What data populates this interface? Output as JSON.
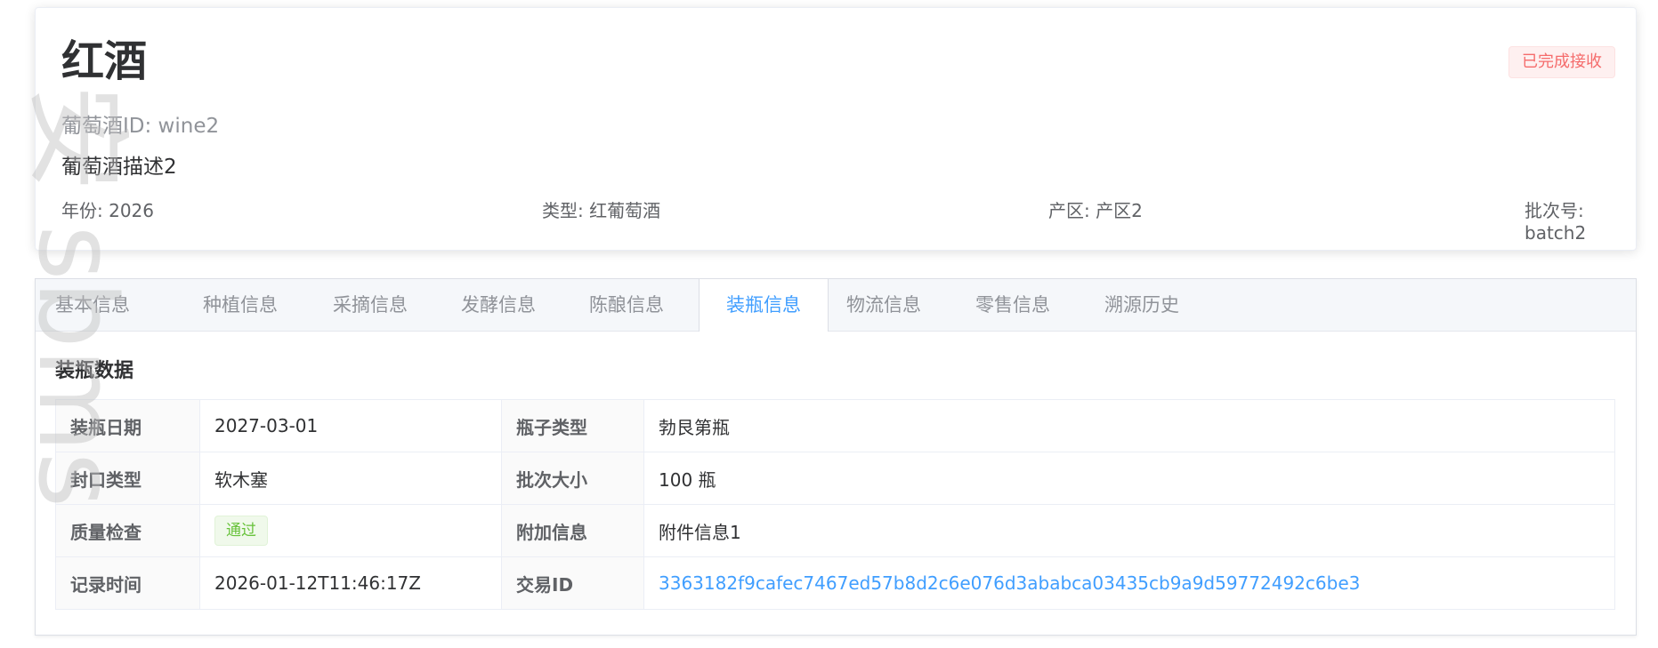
{
  "header": {
    "title": "红酒",
    "wine_id": "葡萄酒ID: wine2",
    "description": "葡萄酒描述2",
    "status": "已完成接收",
    "meta": [
      {
        "label": "年份: 2026"
      },
      {
        "label": "类型: 红葡萄酒"
      },
      {
        "label": "产区: 产区2"
      },
      {
        "label": "批次号: batch2"
      }
    ]
  },
  "tabs": [
    {
      "label": "基本信息"
    },
    {
      "label": "种植信息"
    },
    {
      "label": "采摘信息"
    },
    {
      "label": "发酵信息"
    },
    {
      "label": "陈酿信息"
    },
    {
      "label": "装瓶信息"
    },
    {
      "label": "物流信息"
    },
    {
      "label": "零售信息"
    },
    {
      "label": "溯源历史"
    }
  ],
  "active_tab": "装瓶信息",
  "section": {
    "title": "装瓶数据",
    "rows": [
      {
        "l1": "装瓶日期",
        "v1": "2027-03-01",
        "l2": "瓶子类型",
        "v2": "勃艮第瓶"
      },
      {
        "l1": "封口类型",
        "v1": "软木塞",
        "l2": "批次大小",
        "v2": "100 瓶"
      },
      {
        "l1": "质量检查",
        "v1": "通过",
        "l2": "附加信息",
        "v2": "附件信息1"
      },
      {
        "l1": "记录时间",
        "v1": "2026-01-12T11:46:17Z",
        "l2": "交易ID",
        "v2": "3363182f9cafec7467ed57b8d2c6e076d3ababca03435cb9a9d59772492c6be3"
      }
    ]
  },
  "watermark_text": "安 sbms",
  "colors": {
    "accent": "#409eff",
    "danger": "#f56c6c",
    "success": "#67c23a"
  }
}
